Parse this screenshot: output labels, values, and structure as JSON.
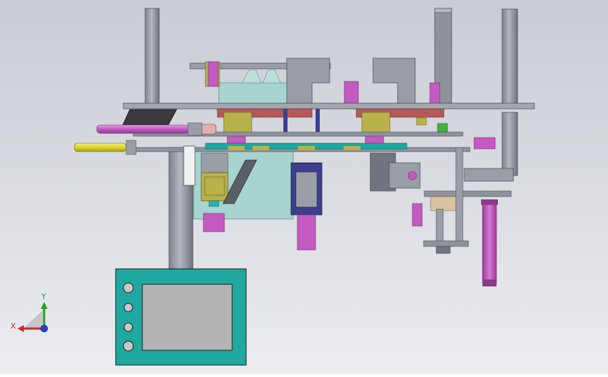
{
  "viewport": {
    "background_top": "#c9ccd3",
    "background_bottom": "#ebedf1"
  },
  "colors": {
    "steel": "#8e929b",
    "steel_dark": "#5a5e66",
    "magenta": "#c45ac2",
    "pink": "#d36fd3",
    "yellow": "#e0d52a",
    "teal": "#17a9a2",
    "cyan": "#2bb0b0",
    "olive": "#b9b24a",
    "navy": "#3d3f8e",
    "brick": "#b35a58",
    "glass": "#a7d4cf",
    "white": "#f2f2f2",
    "green": "#3fb43f",
    "tan": "#d9c3a0"
  },
  "axis_triad": {
    "x_label": "X",
    "y_label": "Y",
    "x_color": "#d0262a",
    "y_color": "#2aa02a",
    "z_color": "#2a3fd0"
  },
  "panel": {
    "frame_color": "#1ea8a0",
    "screen_color": "#b4b4b4",
    "buttons": 4
  }
}
